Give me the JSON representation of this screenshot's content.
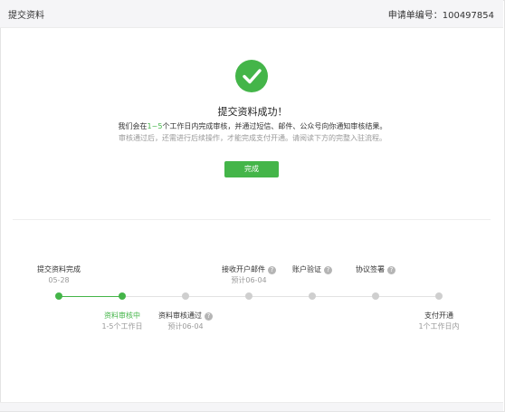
{
  "header": {
    "title": "提交资料",
    "order_no": "申请单编号：100497854"
  },
  "success": {
    "title": "提交资料成功！",
    "desc_prefix": "我们会在",
    "desc_highlight": "1~5",
    "desc_suffix": "个工作日内完成审核，并通过短信、邮件、公众号向你通知审核结果。",
    "note": "审核通过后，还需进行后续操作，才能完成支付开通。请阅读下方的完整入驻流程。",
    "done_label": "完成",
    "accent_color": "#44b549"
  },
  "steps": [
    {
      "label": "提交资料完成",
      "sub": "05-28",
      "status": "done"
    },
    {
      "label": "资料审核中",
      "sub": "1-5个工作日",
      "status": "current"
    },
    {
      "label": "资料审核通过",
      "sub": "预计06-04",
      "status": "pending",
      "help": "?"
    },
    {
      "label": "接收开户邮件",
      "sub": "预计06-04",
      "status": "pending",
      "help": "?"
    },
    {
      "label": "账户验证",
      "sub": "",
      "status": "pending",
      "help": "?"
    },
    {
      "label": "协议签署",
      "sub": "",
      "status": "pending",
      "help": "?"
    },
    {
      "label": "支付开通",
      "sub": "1个工作日内",
      "status": "pending"
    }
  ]
}
